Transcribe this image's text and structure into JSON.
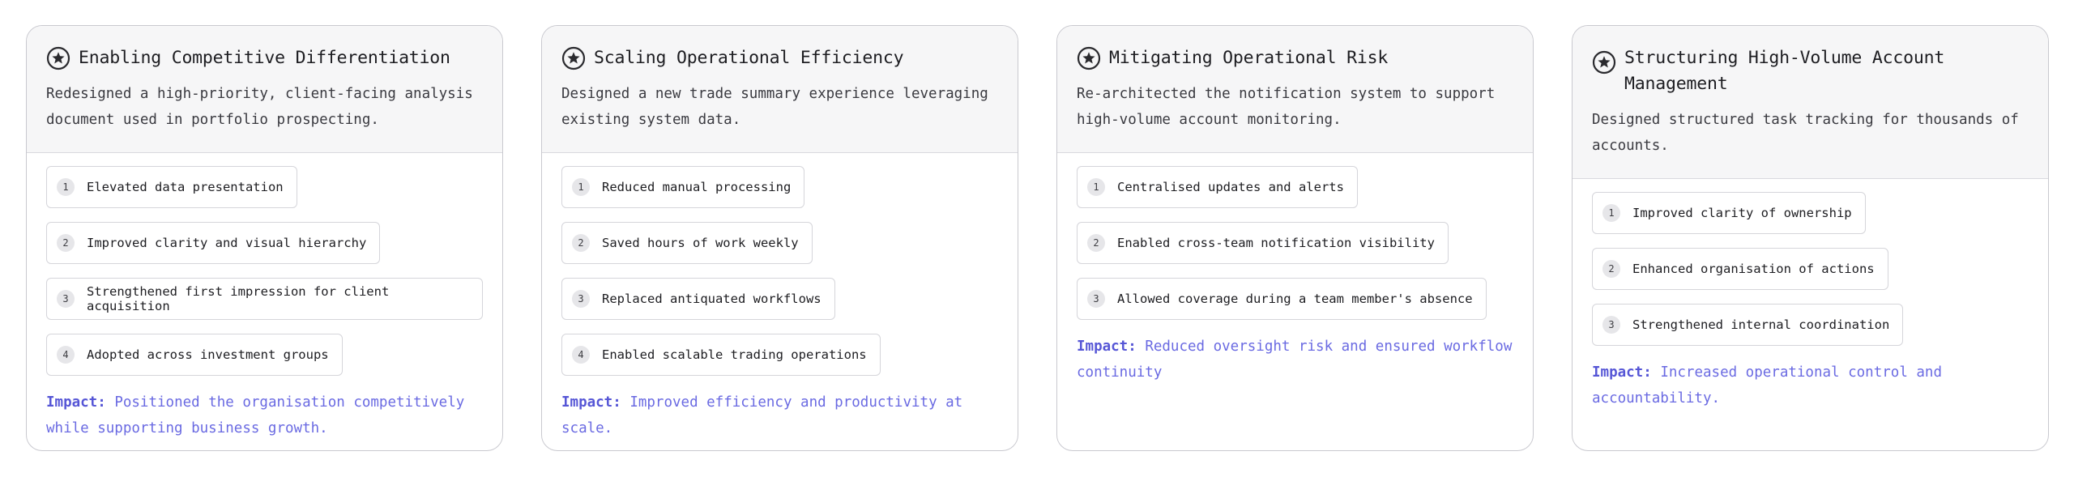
{
  "accent_color": "#6a6ae2",
  "impact_label": "Impact:",
  "cards": [
    {
      "title": "Enabling Competitive Differentiation",
      "description": "Redesigned a high-priority, client-facing analysis document used in portfolio prospecting.",
      "icon": "star-badge-icon",
      "items": [
        {
          "num": "1",
          "label": "Elevated data presentation"
        },
        {
          "num": "2",
          "label": "Improved clarity and visual hierarchy"
        },
        {
          "num": "3",
          "label": "Strengthened first impression for client acquisition"
        },
        {
          "num": "4",
          "label": "Adopted across investment groups"
        }
      ],
      "impact": "Positioned the organisation competitively while supporting business growth."
    },
    {
      "title": "Scaling Operational Efficiency",
      "description": "Designed a new trade summary experience leveraging existing system data.",
      "icon": "star-badge-icon",
      "items": [
        {
          "num": "1",
          "label": "Reduced manual processing"
        },
        {
          "num": "2",
          "label": "Saved hours of work weekly"
        },
        {
          "num": "3",
          "label": "Replaced antiquated workflows"
        },
        {
          "num": "4",
          "label": "Enabled scalable trading operations"
        }
      ],
      "impact": "Improved efficiency and productivity at scale."
    },
    {
      "title": "Mitigating Operational Risk",
      "description": "Re-architected the notification system to support high-volume account monitoring.",
      "icon": "star-badge-icon",
      "items": [
        {
          "num": "1",
          "label": "Centralised updates and alerts"
        },
        {
          "num": "2",
          "label": "Enabled cross-team notification visibility"
        },
        {
          "num": "3",
          "label": "Allowed coverage during a team member's absence"
        }
      ],
      "impact": "Reduced oversight risk and ensured workflow continuity"
    },
    {
      "title": "Structuring High-Volume Account Management",
      "description": "Designed structured task tracking for thousands of accounts.",
      "icon": "star-badge-icon",
      "items": [
        {
          "num": "1",
          "label": "Improved clarity of ownership"
        },
        {
          "num": "2",
          "label": "Enhanced organisation of actions"
        },
        {
          "num": "3",
          "label": "Strengthened internal coordination"
        }
      ],
      "impact": "Increased operational control and accountability."
    }
  ]
}
